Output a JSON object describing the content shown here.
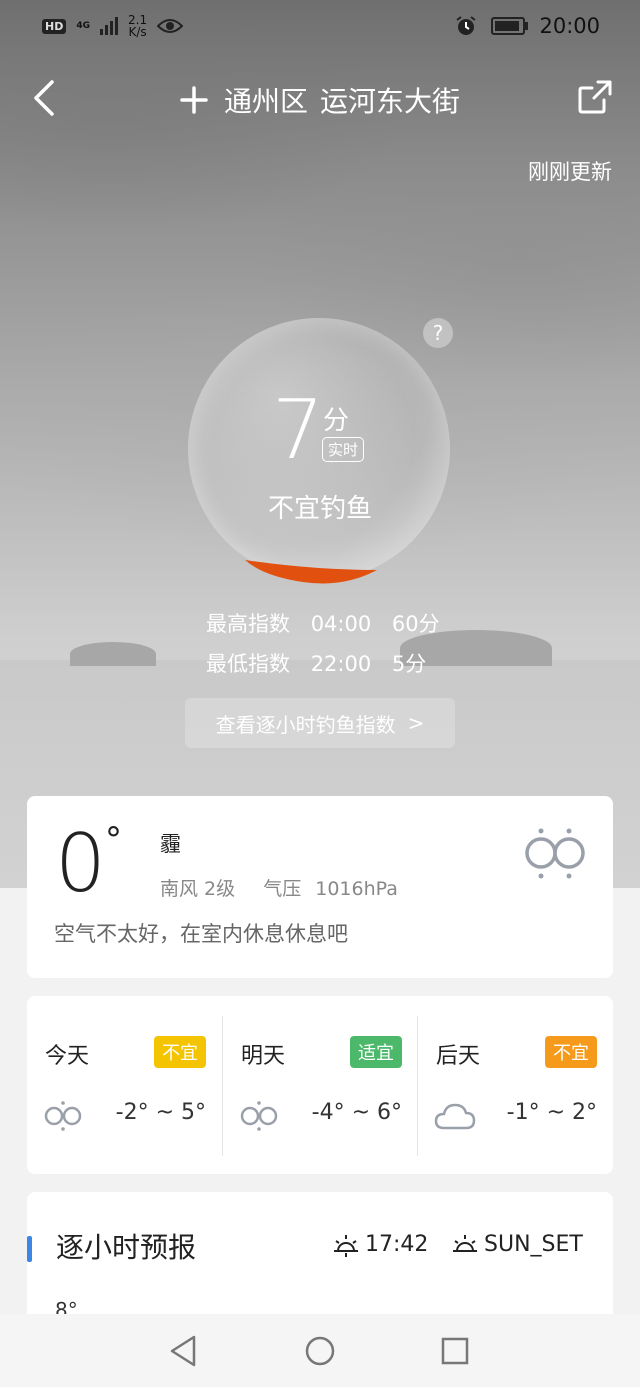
{
  "status_bar": {
    "network": "HD",
    "net_gen": "4G",
    "speed_value": "2.1",
    "speed_unit": "K/s",
    "time": "20:00"
  },
  "header": {
    "location_district": "通州区",
    "location_street": "运河东大街",
    "update_status": "刚刚更新"
  },
  "fishing": {
    "score": "7",
    "unit": "分",
    "realtime_tag": "实时",
    "verdict": "不宜钓鱼",
    "highest_label": "最高指数",
    "highest_time": "04:00",
    "highest_score": "60分",
    "lowest_label": "最低指数",
    "lowest_time": "22:00",
    "lowest_score": "5分",
    "hourly_button": "查看逐小时钓鱼指数",
    "hourly_arrow": ">",
    "help": "?"
  },
  "current": {
    "temp": "0",
    "deg": "°",
    "condition": "霾",
    "wind": "南风  2级",
    "pressure_label": "气压",
    "pressure_value": "1016hPa",
    "advice": "空气不太好，在室内休息休息吧"
  },
  "forecast": [
    {
      "day": "今天",
      "tag": "不宜",
      "tag_color": "#f5c400",
      "icon": "haze-icon",
      "range": "-2° ~ 5°"
    },
    {
      "day": "明天",
      "tag": "适宜",
      "tag_color": "#4cb86a",
      "icon": "haze-icon",
      "range": "-4° ~ 6°"
    },
    {
      "day": "后天",
      "tag": "不宜",
      "tag_color": "#f59a1a",
      "icon": "cloud-icon",
      "range": "-1° ~ 2°"
    }
  ],
  "hourly": {
    "title": "逐小时预报",
    "sunset_time": "17:42",
    "sun_event": "SUN_SET",
    "partial_temp": "8°"
  },
  "colors": {
    "accent": "#3c87e6",
    "gauge": "#e2500f"
  }
}
